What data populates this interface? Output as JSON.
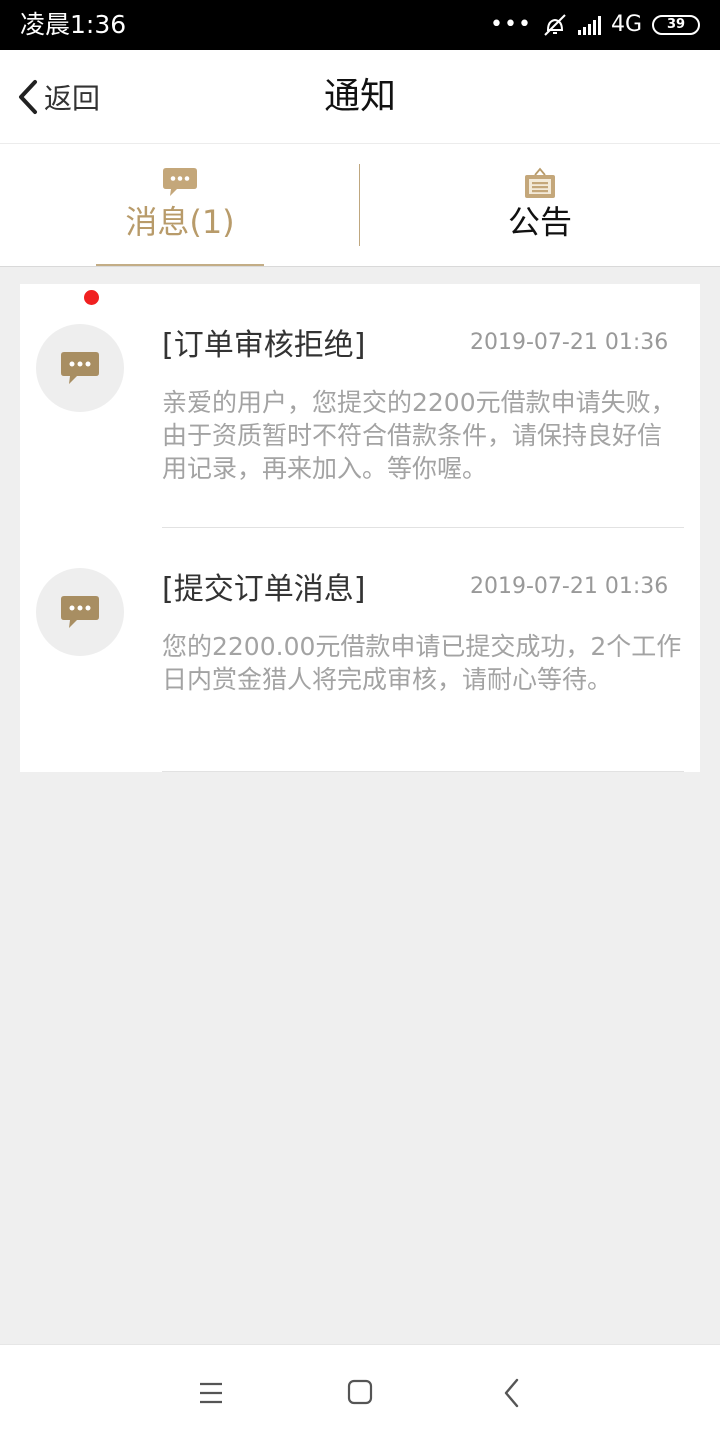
{
  "status_bar": {
    "time": "凌晨1:36",
    "dots": "•••",
    "network": "4G",
    "battery": "39"
  },
  "header": {
    "back_label": "返回",
    "title": "通知"
  },
  "tabs": [
    {
      "label": "消息(1)",
      "icon": "chat-bubble-icon",
      "active": true
    },
    {
      "label": "公告",
      "icon": "notice-board-icon",
      "active": false
    }
  ],
  "messages": [
    {
      "title": "[订单审核拒绝]",
      "time": "2019-07-21 01:36",
      "body": "亲爱的用户，您提交的2200元借款申请失败，由于资质暂时不符合借款条件，请保持良好信用记录，再来加入。等你喔。",
      "unread": false
    },
    {
      "title": "[提交订单消息]",
      "time": "2019-07-21 01:36",
      "body": "您的2200.00元借款申请已提交成功，2个工作日内赏金猎人将完成审核，请耐心等待。",
      "unread": true
    }
  ],
  "colors": {
    "accent": "#b89b6a",
    "unread": "#f02020",
    "background": "#efefef"
  },
  "system_nav": {
    "icons": [
      "menu-icon",
      "home-icon",
      "back-icon"
    ]
  }
}
